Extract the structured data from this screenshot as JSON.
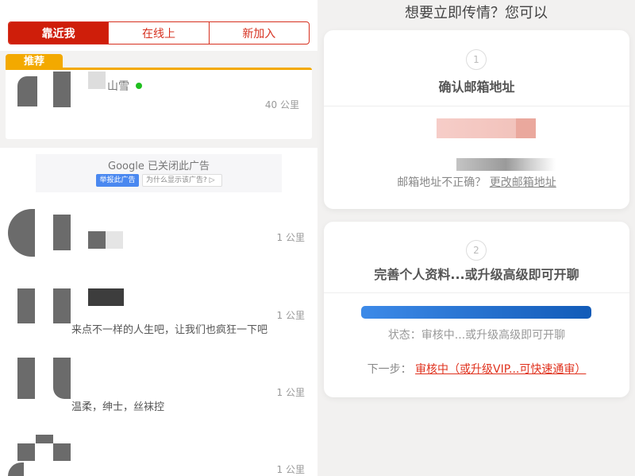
{
  "left": {
    "tabs": [
      {
        "label": "靠近我",
        "active": true
      },
      {
        "label": "在线上",
        "active": false
      },
      {
        "label": "新加入",
        "active": false
      }
    ],
    "recommended": {
      "tag": "推荐",
      "name_partial": "山雪",
      "online": true,
      "distance": "40 公里"
    },
    "ad": {
      "title": "Google 已关闭此广告",
      "report_button": "举报此广告",
      "why_button": "为什么显示该广告?"
    },
    "users": [
      {
        "distance": "1 公里",
        "bio": ""
      },
      {
        "distance": "1 公里",
        "bio": "来点不一样的人生吧，让我们也疯狂一下吧"
      },
      {
        "distance": "1 公里",
        "bio": "温柔，绅士，丝袜控"
      },
      {
        "distance": "1 公里",
        "bio": ""
      }
    ]
  },
  "right": {
    "title": "想要立即传情？您可以",
    "step1": {
      "number": "1",
      "title": "确认邮箱地址",
      "wrong_prompt": "邮箱地址不正确？",
      "change_link": "更改邮箱地址"
    },
    "step2": {
      "number": "2",
      "title": "完善个人资料...或升级高级即可开聊",
      "progress": 1.0,
      "status": "状态：审核中...或升级高级即可开聊",
      "next_label": "下一步：",
      "next_link": "审核中（或升级VIP...可快速通审）"
    },
    "colors": {
      "accent": "#d6301f",
      "progress_start": "#3d8ae8",
      "progress_end": "#125bb8",
      "link_red": "#e0321e"
    }
  }
}
